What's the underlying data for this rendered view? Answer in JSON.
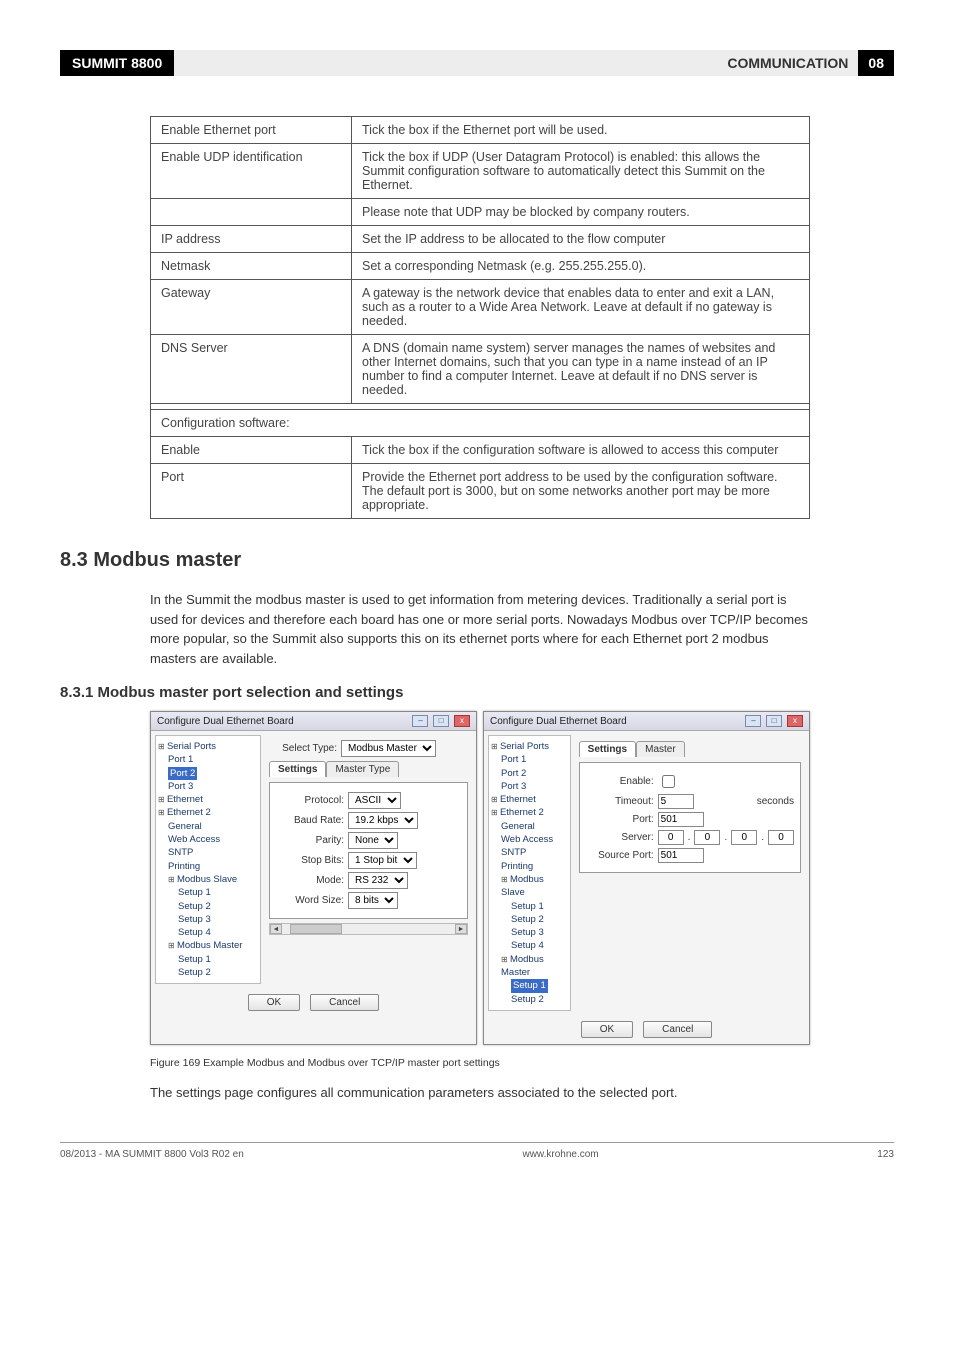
{
  "header": {
    "product": "SUMMIT 8800",
    "section": "COMMUNICATION",
    "chapter": "08"
  },
  "table": {
    "rows": [
      {
        "label": "Enable Ethernet port",
        "desc": "Tick the box if the Ethernet port will be used."
      },
      {
        "label": "Enable UDP identification",
        "desc": "Tick the box if UDP (User Datagram Protocol) is enabled: this allows the Summit configuration software to automatically detect this Summit on the Ethernet."
      },
      {
        "label": "",
        "desc": "Please note that UDP may be blocked by company routers."
      },
      {
        "label": "IP address",
        "desc": "Set the IP address to be allocated to the flow computer"
      },
      {
        "label": "Netmask",
        "desc": "Set a corresponding Netmask (e.g. 255.255.255.0)."
      },
      {
        "label": "Gateway",
        "desc": "A gateway is the network device that enables data to enter and exit a LAN, such as a router to a Wide Area Network. Leave at default if no gateway is needed."
      },
      {
        "label": "DNS Server",
        "desc": "A DNS (domain name system) server manages the names of websites and other Internet domains, such that you can type in a name instead of an IP number to find a computer Internet. Leave at default if no DNS server is needed."
      }
    ],
    "subhead": "Configuration software:",
    "rows2": [
      {
        "label": "Enable",
        "desc": "Tick the box if the configuration software is allowed to access this computer"
      },
      {
        "label": "Port",
        "desc": "Provide the Ethernet port address to be used by the configuration software. The default port is 3000, but on some networks another port may be more appropriate."
      }
    ]
  },
  "sec83": {
    "title": "8.3 Modbus master",
    "para": "In the Summit the modbus master is used to get information from metering devices. Traditionally a serial port is used for devices and therefore each board has one or more serial ports. Nowadays Modbus over TCP/IP becomes more popular, so the Summit also supports this on its ethernet ports where for each Ethernet port 2 modbus masters are available."
  },
  "sec831": {
    "title": "8.3.1 Modbus master port selection and settings"
  },
  "win_title": "Configure Dual Ethernet Board",
  "tree_items": {
    "serial_ports": "Serial Ports",
    "port1": "Port 1",
    "port2": "Port 2",
    "port3": "Port 3",
    "ethernet": "Ethernet",
    "ethernet2": "Ethernet 2",
    "general": "General",
    "web_access": "Web Access",
    "sntp": "SNTP",
    "printing": "Printing",
    "modbus_slave": "Modbus Slave",
    "setup1": "Setup 1",
    "setup2": "Setup 2",
    "setup3": "Setup 3",
    "setup4": "Setup 4",
    "modbus_master": "Modbus Master"
  },
  "left_panel": {
    "select_type_lbl": "Select Type:",
    "select_type_val": "Modbus Master",
    "tab_settings": "Settings",
    "tab_master_type": "Master Type",
    "protocol_lbl": "Protocol:",
    "protocol_val": "ASCII",
    "baud_lbl": "Baud Rate:",
    "baud_val": "19.2 kbps",
    "parity_lbl": "Parity:",
    "parity_val": "None",
    "stop_lbl": "Stop Bits:",
    "stop_val": "1 Stop bit",
    "mode_lbl": "Mode:",
    "mode_val": "RS 232",
    "word_lbl": "Word Size:",
    "word_val": "8 bits"
  },
  "right_panel": {
    "tab_settings": "Settings",
    "tab_master": "Master",
    "enable_lbl": "Enable:",
    "timeout_lbl": "Timeout:",
    "timeout_val": "5",
    "timeout_unit": "seconds",
    "port_lbl": "Port:",
    "port_val": "501",
    "server_lbl": "Server:",
    "server_ip": [
      "0",
      "0",
      "0",
      "0"
    ],
    "srcport_lbl": "Source Port:",
    "srcport_val": "501"
  },
  "buttons": {
    "ok": "OK",
    "cancel": "Cancel"
  },
  "caption": "Figure 169    Example Modbus and Modbus over TCP/IP master port settings",
  "after_fig": "The settings page configures all communication parameters associated to the selected port.",
  "footer": {
    "left": "08/2013 - MA SUMMIT 8800 Vol3 R02 en",
    "center": "www.krohne.com",
    "right": "123"
  }
}
